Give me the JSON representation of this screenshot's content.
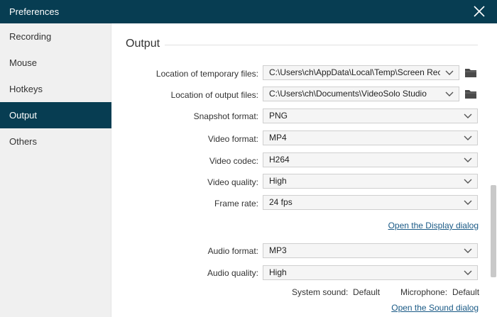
{
  "window": {
    "title": "Preferences",
    "close_icon": "close-icon"
  },
  "sidebar": {
    "items": [
      {
        "label": "Recording"
      },
      {
        "label": "Mouse"
      },
      {
        "label": "Hotkeys"
      },
      {
        "label": "Output",
        "active": true
      },
      {
        "label": "Others"
      }
    ]
  },
  "output": {
    "section_title": "Output",
    "temp_files": {
      "label": "Location of temporary files:",
      "value": "C:\\Users\\ch\\AppData\\Local\\Temp\\Screen Rec"
    },
    "output_files": {
      "label": "Location of output files:",
      "value": "C:\\Users\\ch\\Documents\\VideoSolo Studio"
    },
    "snapshot_format": {
      "label": "Snapshot format:",
      "value": "PNG"
    },
    "video_format": {
      "label": "Video format:",
      "value": "MP4"
    },
    "video_codec": {
      "label": "Video codec:",
      "value": "H264"
    },
    "video_quality": {
      "label": "Video quality:",
      "value": "High"
    },
    "frame_rate": {
      "label": "Frame rate:",
      "value": "24 fps"
    },
    "display_dialog_link": "Open the Display dialog",
    "audio_format": {
      "label": "Audio format:",
      "value": "MP3"
    },
    "audio_quality": {
      "label": "Audio quality:",
      "value": "High"
    },
    "system_sound": {
      "label": "System sound:",
      "value": "Default"
    },
    "microphone": {
      "label": "Microphone:",
      "value": "Default"
    },
    "sound_dialog_link": "Open the Sound dialog"
  },
  "colors": {
    "titlebar": "#073d52",
    "active_nav": "#073d52",
    "link": "#1a5a86"
  }
}
